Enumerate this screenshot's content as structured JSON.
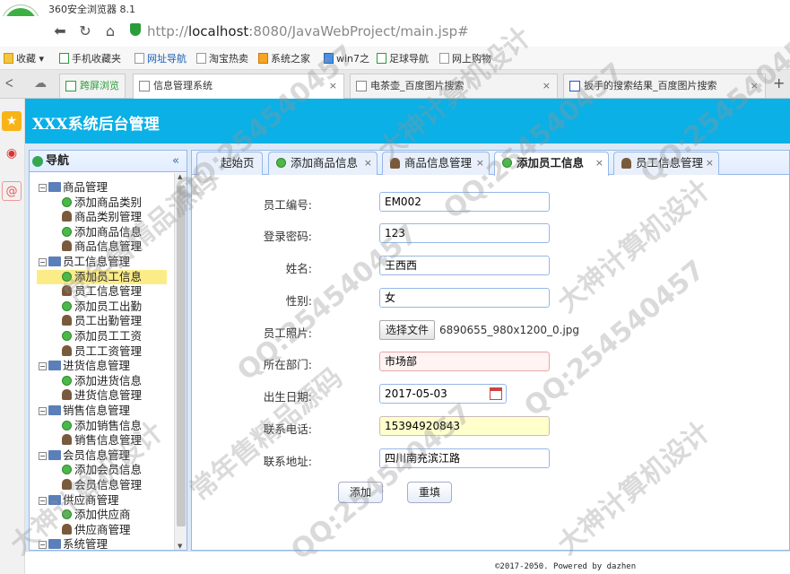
{
  "browser": {
    "title": "360安全浏览器 8.1",
    "logo": "e",
    "url_prefix": "http://",
    "url_host": "localhost",
    "url_rest": ":8080/JavaWebProject/main.jsp#",
    "bookmarks": [
      "收藏",
      "手机收藏夹",
      "网址导航",
      "淘宝热卖",
      "系统之家",
      "win7之",
      "足球导航",
      "网上购物"
    ],
    "tabs": [
      {
        "label": "跨屏浏览"
      },
      {
        "label": "信息管理系统"
      },
      {
        "label": "电茶壶_百度图片搜索"
      },
      {
        "label": "扳手的搜索结果_百度图片搜索"
      }
    ]
  },
  "app": {
    "header_title": "XXX系统后台管理",
    "nav_title": "导航",
    "nav_collapse": "«",
    "tree": [
      {
        "label": "商品管理",
        "type": "group"
      },
      {
        "label": "添加商品类别",
        "type": "add"
      },
      {
        "label": "商品类别管理",
        "type": "user"
      },
      {
        "label": "添加商品信息",
        "type": "add"
      },
      {
        "label": "商品信息管理",
        "type": "user"
      },
      {
        "label": "员工信息管理",
        "type": "group"
      },
      {
        "label": "添加员工信息",
        "type": "add",
        "selected": true
      },
      {
        "label": "员工信息管理",
        "type": "user"
      },
      {
        "label": "添加员工出勤",
        "type": "add"
      },
      {
        "label": "员工出勤管理",
        "type": "user"
      },
      {
        "label": "添加员工工资",
        "type": "add"
      },
      {
        "label": "员工工资管理",
        "type": "user"
      },
      {
        "label": "进货信息管理",
        "type": "group"
      },
      {
        "label": "添加进货信息",
        "type": "add"
      },
      {
        "label": "进货信息管理",
        "type": "user"
      },
      {
        "label": "销售信息管理",
        "type": "group"
      },
      {
        "label": "添加销售信息",
        "type": "add"
      },
      {
        "label": "销售信息管理",
        "type": "user"
      },
      {
        "label": "会员信息管理",
        "type": "group"
      },
      {
        "label": "添加会员信息",
        "type": "add"
      },
      {
        "label": "会员信息管理",
        "type": "user"
      },
      {
        "label": "供应商管理",
        "type": "group"
      },
      {
        "label": "添加供应商",
        "type": "add"
      },
      {
        "label": "供应商管理",
        "type": "user"
      },
      {
        "label": "系统管理",
        "type": "group"
      }
    ],
    "content_tabs": [
      {
        "label": "起始页"
      },
      {
        "label": "添加商品信息"
      },
      {
        "label": "商品信息管理"
      },
      {
        "label": "添加员工信息"
      },
      {
        "label": "员工信息管理"
      }
    ],
    "form": {
      "emp_no_label": "员工编号:",
      "emp_no": "EM002",
      "password_label": "登录密码:",
      "password": "123",
      "name_label": "姓名:",
      "name": "王西西",
      "gender_label": "性别:",
      "gender": "女",
      "photo_label": "员工照片:",
      "photo_button": "选择文件",
      "photo_file": "6890655_980x1200_0.jpg",
      "dept_label": "所在部门:",
      "dept": "市场部",
      "birth_label": "出生日期:",
      "birth": "2017-05-03",
      "phone_label": "联系电话:",
      "phone": "15394920843",
      "address_label": "联系地址:",
      "address": "四川南充滨江路",
      "add_button": "添加",
      "reset_button": "重填"
    },
    "footer": "©2017-2050. Powered by dazhen",
    "close_glyph": "×"
  },
  "watermark": {
    "qq": "QQ:254540457",
    "text1": "大神计算机设计",
    "text2": "常年售精品源码"
  }
}
